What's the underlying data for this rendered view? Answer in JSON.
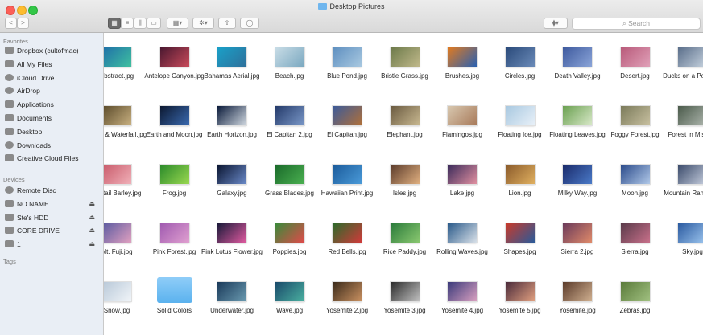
{
  "window": {
    "title": "Desktop Pictures"
  },
  "toolbar": {
    "back": "<",
    "forward": ">",
    "view_icon": "▦",
    "view_list": "≡",
    "view_columns": "⫼",
    "view_cover": "▭",
    "arrange": "▦▾",
    "action": "✲▾",
    "share": "⇧",
    "tag": "◯",
    "dropbox": "⧫▾",
    "search_placeholder": "Search"
  },
  "sidebar": {
    "favorites_label": "Favorites",
    "favorites": [
      {
        "label": "Dropbox (cultofmac)",
        "icon": "dropbox-icon"
      },
      {
        "label": "All My Files",
        "icon": "all-files-icon"
      },
      {
        "label": "iCloud Drive",
        "icon": "cloud-icon"
      },
      {
        "label": "AirDrop",
        "icon": "airdrop-icon"
      },
      {
        "label": "Applications",
        "icon": "applications-icon"
      },
      {
        "label": "Documents",
        "icon": "documents-icon"
      },
      {
        "label": "Desktop",
        "icon": "desktop-icon"
      },
      {
        "label": "Downloads",
        "icon": "downloads-icon"
      },
      {
        "label": "Creative Cloud Files",
        "icon": "folder-icon"
      }
    ],
    "devices_label": "Devices",
    "devices": [
      {
        "label": "Remote Disc",
        "icon": "disc-icon",
        "eject": ""
      },
      {
        "label": "NO NAME",
        "icon": "drive-icon",
        "eject": "⏏"
      },
      {
        "label": "Ste's HDD",
        "icon": "drive-icon",
        "eject": "⏏"
      },
      {
        "label": "CORE DRIVE",
        "icon": "drive-icon",
        "eject": "⏏"
      },
      {
        "label": "1",
        "icon": "drive-icon",
        "eject": "⏏"
      }
    ],
    "tags_label": "Tags"
  },
  "files": [
    {
      "name": "Abstract.jpg",
      "c1": "#1f6fa8",
      "c2": "#3fc0a0"
    },
    {
      "name": "Antelope Canyon.jpg",
      "c1": "#4a1830",
      "c2": "#c84a5a"
    },
    {
      "name": "Bahamas Aerial.jpg",
      "c1": "#1aa0c8",
      "c2": "#2e6f9a"
    },
    {
      "name": "Beach.jpg",
      "c1": "#c8dce6",
      "c2": "#7aa8c0"
    },
    {
      "name": "Blue Pond.jpg",
      "c1": "#5e8fc0",
      "c2": "#a8c8e0"
    },
    {
      "name": "Bristle Grass.jpg",
      "c1": "#6c7a4a",
      "c2": "#c0b88a"
    },
    {
      "name": "Brushes.jpg",
      "c1": "#e07a20",
      "c2": "#2a60b0"
    },
    {
      "name": "Circles.jpg",
      "c1": "#2a4a7a",
      "c2": "#6a8ab8"
    },
    {
      "name": "Death Valley.jpg",
      "c1": "#3e5a9e",
      "c2": "#8aa4d8"
    },
    {
      "name": "Desert.jpg",
      "c1": "#b85a7a",
      "c2": "#e0a0b8"
    },
    {
      "name": "Ducks on a Pond.jpg",
      "c1": "#5a6e8a",
      "c2": "#c8d4e0"
    },
    {
      "name": "Eagle & Waterfall.jpg",
      "c1": "#5a4a2a",
      "c2": "#c8b080"
    },
    {
      "name": "Earth and Moon.jpg",
      "c1": "#0c1830",
      "c2": "#3a6ab0"
    },
    {
      "name": "Earth Horizon.jpg",
      "c1": "#0a1a3a",
      "c2": "#d0d8e0"
    },
    {
      "name": "El Capitan 2.jpg",
      "c1": "#243a6a",
      "c2": "#7a98c8"
    },
    {
      "name": "El Capitan.jpg",
      "c1": "#3a5a9a",
      "c2": "#b0703a"
    },
    {
      "name": "Elephant.jpg",
      "c1": "#6a5a40",
      "c2": "#c8b890"
    },
    {
      "name": "Flamingos.jpg",
      "c1": "#d8c8b0",
      "c2": "#a87a5a"
    },
    {
      "name": "Floating Ice.jpg",
      "c1": "#a8c8e0",
      "c2": "#e8f0f8"
    },
    {
      "name": "Floating Leaves.jpg",
      "c1": "#6aa050",
      "c2": "#d8e8c8"
    },
    {
      "name": "Foggy Forest.jpg",
      "c1": "#7a7a5a",
      "c2": "#c8c0a0"
    },
    {
      "name": "Forest in Mist.jpg",
      "c1": "#4a5a4a",
      "c2": "#b0b8b0"
    },
    {
      "name": "Foxtail Barley.jpg",
      "c1": "#c85a6a",
      "c2": "#f0b0b8"
    },
    {
      "name": "Frog.jpg",
      "c1": "#2a8a2a",
      "c2": "#9ad850"
    },
    {
      "name": "Galaxy.jpg",
      "c1": "#0a1430",
      "c2": "#6a8ac8"
    },
    {
      "name": "Grass Blades.jpg",
      "c1": "#1a6a2a",
      "c2": "#4ab050"
    },
    {
      "name": "Hawaiian Print.jpg",
      "c1": "#1a5a9a",
      "c2": "#4a9ad8"
    },
    {
      "name": "Isles.jpg",
      "c1": "#5a3a2a",
      "c2": "#e0b080"
    },
    {
      "name": "Lake.jpg",
      "c1": "#3a2a5a",
      "c2": "#e090a0"
    },
    {
      "name": "Lion.jpg",
      "c1": "#8a5a2a",
      "c2": "#e0b060"
    },
    {
      "name": "Milky Way.jpg",
      "c1": "#1a2a6a",
      "c2": "#4a7ac8"
    },
    {
      "name": "Moon.jpg",
      "c1": "#2a4a8a",
      "c2": "#b0c8e8"
    },
    {
      "name": "Mountain Range.jpg",
      "c1": "#3a4a6a",
      "c2": "#c8d0e0"
    },
    {
      "name": "Mt. Fuji.jpg",
      "c1": "#5a5aa0",
      "c2": "#e0a0c0"
    },
    {
      "name": "Pink Forest.jpg",
      "c1": "#a05ab0",
      "c2": "#e0a0d0"
    },
    {
      "name": "Pink Lotus Flower.jpg",
      "c1": "#1a1a3a",
      "c2": "#e05aa0"
    },
    {
      "name": "Poppies.jpg",
      "c1": "#3a8a3a",
      "c2": "#e04a4a"
    },
    {
      "name": "Red Bells.jpg",
      "c1": "#2a6a2a",
      "c2": "#d03a3a"
    },
    {
      "name": "Rice Paddy.jpg",
      "c1": "#2a7a3a",
      "c2": "#8ac870"
    },
    {
      "name": "Rolling Waves.jpg",
      "c1": "#2a5a8a",
      "c2": "#d8e0e8"
    },
    {
      "name": "Shapes.jpg",
      "c1": "#c83a2a",
      "c2": "#2a5a9a"
    },
    {
      "name": "Sierra 2.jpg",
      "c1": "#6a3a5a",
      "c2": "#e08a6a"
    },
    {
      "name": "Sierra.jpg",
      "c1": "#5a3a4a",
      "c2": "#c8708a"
    },
    {
      "name": "Sky.jpg",
      "c1": "#2a5aa0",
      "c2": "#a0c8f0"
    },
    {
      "name": "Snow.jpg",
      "c1": "#b8c8d8",
      "c2": "#f0f4f8"
    },
    {
      "name": "Solid Colors",
      "folder": true
    },
    {
      "name": "Underwater.jpg",
      "c1": "#1a3a5a",
      "c2": "#6a9ab0"
    },
    {
      "name": "Wave.jpg",
      "c1": "#1a4a6a",
      "c2": "#4ab0a0"
    },
    {
      "name": "Yosemite 2.jpg",
      "c1": "#3a2a1a",
      "c2": "#c89060"
    },
    {
      "name": "Yosemite 3.jpg",
      "c1": "#2a2a2a",
      "c2": "#c0c0c0"
    },
    {
      "name": "Yosemite 4.jpg",
      "c1": "#3a3a7a",
      "c2": "#d8a0c0"
    },
    {
      "name": "Yosemite 5.jpg",
      "c1": "#4a2a3a",
      "c2": "#e0a080"
    },
    {
      "name": "Yosemite.jpg",
      "c1": "#5a3a2a",
      "c2": "#d0b090"
    },
    {
      "name": "Zebras.jpg",
      "c1": "#5a7a3a",
      "c2": "#a0c080"
    }
  ]
}
